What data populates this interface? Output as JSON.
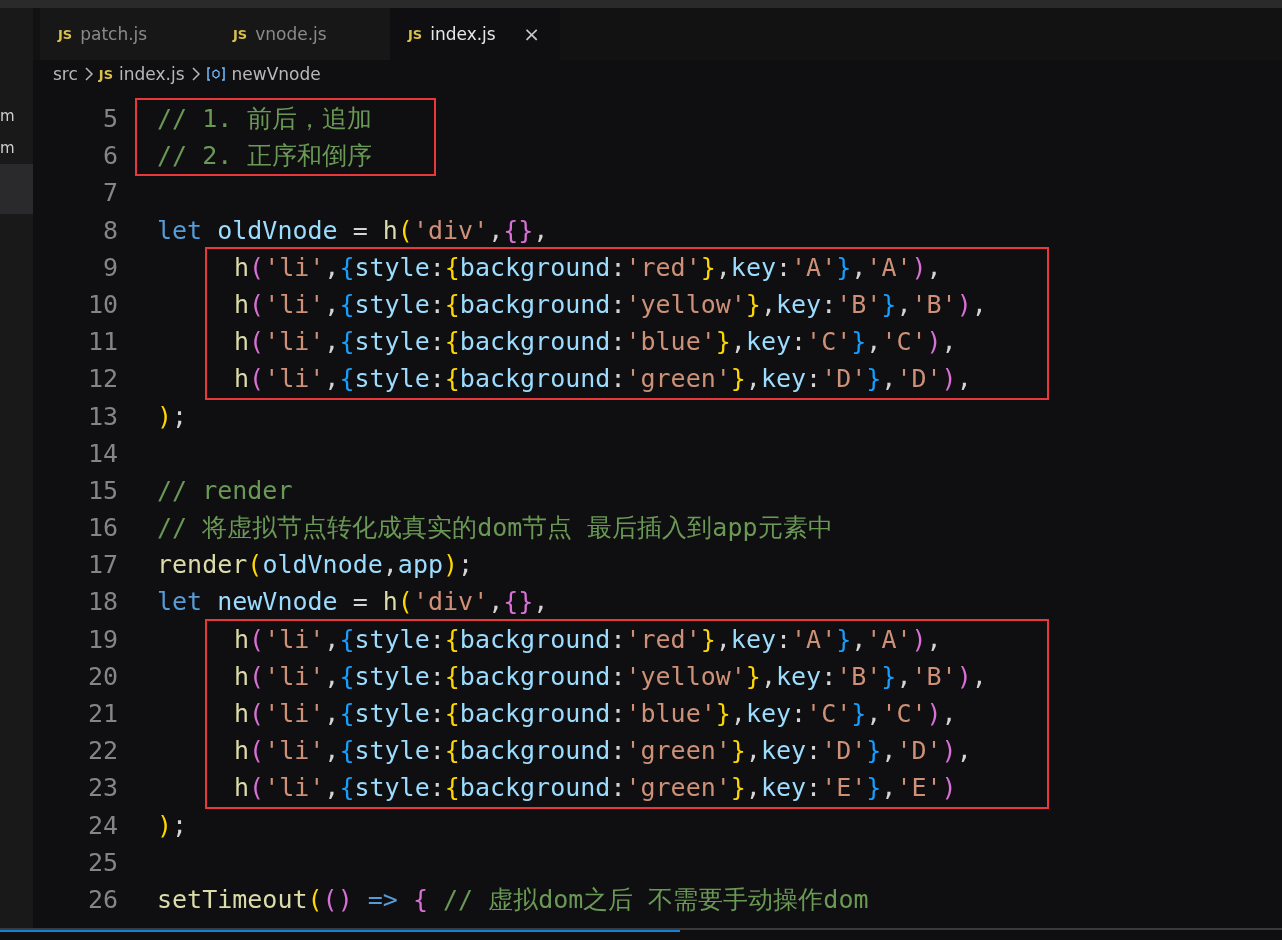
{
  "sidebar": {
    "items": [
      {
        "label": "m",
        "selected": false
      },
      {
        "label": "m",
        "selected": false
      }
    ]
  },
  "tabs": [
    {
      "label": "patch.js",
      "badge": "JS",
      "selected": false
    },
    {
      "label": "vnode.js",
      "badge": "JS",
      "selected": false
    },
    {
      "label": "index.js",
      "badge": "JS",
      "selected": true,
      "close": "×"
    }
  ],
  "breadcrumb": [
    {
      "kind": "folder",
      "label": "src"
    },
    {
      "kind": "file",
      "badge": "JS",
      "label": "index.js"
    },
    {
      "kind": "symbol",
      "label": "newVnode"
    }
  ],
  "editor": {
    "segments": [
      {
        "kind": "box",
        "indented": false,
        "lines": [
          {
            "number": "5",
            "tokens": [
              {
                "kind": "cm",
                "text": "// 1. 前后，追加"
              }
            ]
          },
          {
            "number": "6",
            "tokens": [
              {
                "kind": "cm",
                "text": "// 2. 正序和倒序"
              }
            ]
          }
        ]
      },
      {
        "kind": "line",
        "number": "7"
      },
      {
        "kind": "line",
        "number": "8",
        "tokens": [
          {
            "kind": "kw",
            "text": "let "
          },
          {
            "kind": "var",
            "text": "oldVnode"
          },
          {
            "kind": "p",
            "text": " = "
          },
          {
            "kind": "fn",
            "text": "h"
          },
          {
            "kind": "b1",
            "text": "("
          },
          {
            "kind": "str",
            "text": "'div'"
          },
          {
            "kind": "p",
            "text": ","
          },
          {
            "kind": "b2",
            "text": "{}"
          },
          {
            "kind": "p",
            "text": ","
          }
        ]
      },
      {
        "kind": "box",
        "indented": true,
        "lines": [
          {
            "number": "9",
            "tokens": [
              {
                "kind": "fn",
                "text": "h"
              },
              {
                "kind": "b2",
                "text": "("
              },
              {
                "kind": "str",
                "text": "'li'"
              },
              {
                "kind": "p",
                "text": ","
              },
              {
                "kind": "b3",
                "text": "{"
              },
              {
                "kind": "var",
                "text": "style"
              },
              {
                "kind": "p",
                "text": ":"
              },
              {
                "kind": "b1",
                "text": "{"
              },
              {
                "kind": "var",
                "text": "background"
              },
              {
                "kind": "p",
                "text": ":"
              },
              {
                "kind": "str",
                "text": "'red'"
              },
              {
                "kind": "b1",
                "text": "}"
              },
              {
                "kind": "p",
                "text": ","
              },
              {
                "kind": "var",
                "text": "key"
              },
              {
                "kind": "p",
                "text": ":"
              },
              {
                "kind": "str",
                "text": "'A'"
              },
              {
                "kind": "b3",
                "text": "}"
              },
              {
                "kind": "p",
                "text": ","
              },
              {
                "kind": "str",
                "text": "'A'"
              },
              {
                "kind": "b2",
                "text": ")"
              },
              {
                "kind": "p",
                "text": ","
              }
            ]
          },
          {
            "number": "10",
            "tokens": [
              {
                "kind": "fn",
                "text": "h"
              },
              {
                "kind": "b2",
                "text": "("
              },
              {
                "kind": "str",
                "text": "'li'"
              },
              {
                "kind": "p",
                "text": ","
              },
              {
                "kind": "b3",
                "text": "{"
              },
              {
                "kind": "var",
                "text": "style"
              },
              {
                "kind": "p",
                "text": ":"
              },
              {
                "kind": "b1",
                "text": "{"
              },
              {
                "kind": "var",
                "text": "background"
              },
              {
                "kind": "p",
                "text": ":"
              },
              {
                "kind": "str",
                "text": "'yellow'"
              },
              {
                "kind": "b1",
                "text": "}"
              },
              {
                "kind": "p",
                "text": ","
              },
              {
                "kind": "var",
                "text": "key"
              },
              {
                "kind": "p",
                "text": ":"
              },
              {
                "kind": "str",
                "text": "'B'"
              },
              {
                "kind": "b3",
                "text": "}"
              },
              {
                "kind": "p",
                "text": ","
              },
              {
                "kind": "str",
                "text": "'B'"
              },
              {
                "kind": "b2",
                "text": ")"
              },
              {
                "kind": "p",
                "text": ","
              }
            ]
          },
          {
            "number": "11",
            "tokens": [
              {
                "kind": "fn",
                "text": "h"
              },
              {
                "kind": "b2",
                "text": "("
              },
              {
                "kind": "str",
                "text": "'li'"
              },
              {
                "kind": "p",
                "text": ","
              },
              {
                "kind": "b3",
                "text": "{"
              },
              {
                "kind": "var",
                "text": "style"
              },
              {
                "kind": "p",
                "text": ":"
              },
              {
                "kind": "b1",
                "text": "{"
              },
              {
                "kind": "var",
                "text": "background"
              },
              {
                "kind": "p",
                "text": ":"
              },
              {
                "kind": "str",
                "text": "'blue'"
              },
              {
                "kind": "b1",
                "text": "}"
              },
              {
                "kind": "p",
                "text": ","
              },
              {
                "kind": "var",
                "text": "key"
              },
              {
                "kind": "p",
                "text": ":"
              },
              {
                "kind": "str",
                "text": "'C'"
              },
              {
                "kind": "b3",
                "text": "}"
              },
              {
                "kind": "p",
                "text": ","
              },
              {
                "kind": "str",
                "text": "'C'"
              },
              {
                "kind": "b2",
                "text": ")"
              },
              {
                "kind": "p",
                "text": ","
              }
            ]
          },
          {
            "number": "12",
            "tokens": [
              {
                "kind": "fn",
                "text": "h"
              },
              {
                "kind": "b2",
                "text": "("
              },
              {
                "kind": "str",
                "text": "'li'"
              },
              {
                "kind": "p",
                "text": ","
              },
              {
                "kind": "b3",
                "text": "{"
              },
              {
                "kind": "var",
                "text": "style"
              },
              {
                "kind": "p",
                "text": ":"
              },
              {
                "kind": "b1",
                "text": "{"
              },
              {
                "kind": "var",
                "text": "background"
              },
              {
                "kind": "p",
                "text": ":"
              },
              {
                "kind": "str",
                "text": "'green'"
              },
              {
                "kind": "b1",
                "text": "}"
              },
              {
                "kind": "p",
                "text": ","
              },
              {
                "kind": "var",
                "text": "key"
              },
              {
                "kind": "p",
                "text": ":"
              },
              {
                "kind": "str",
                "text": "'D'"
              },
              {
                "kind": "b3",
                "text": "}"
              },
              {
                "kind": "p",
                "text": ","
              },
              {
                "kind": "str",
                "text": "'D'"
              },
              {
                "kind": "b2",
                "text": ")"
              },
              {
                "kind": "p",
                "text": ","
              }
            ]
          }
        ]
      },
      {
        "kind": "line",
        "number": "13",
        "tokens": [
          {
            "kind": "b1",
            "text": ")"
          },
          {
            "kind": "p",
            "text": ";"
          }
        ]
      },
      {
        "kind": "line",
        "number": "14"
      },
      {
        "kind": "line",
        "number": "15",
        "tokens": [
          {
            "kind": "cm",
            "text": "// render"
          }
        ]
      },
      {
        "kind": "line",
        "number": "16",
        "tokens": [
          {
            "kind": "cm",
            "text": "// 将虚拟节点转化成真实的dom节点 最后插入到app元素中"
          }
        ]
      },
      {
        "kind": "line",
        "number": "17",
        "tokens": [
          {
            "kind": "fn",
            "text": "render"
          },
          {
            "kind": "b1",
            "text": "("
          },
          {
            "kind": "var",
            "text": "oldVnode"
          },
          {
            "kind": "p",
            "text": ","
          },
          {
            "kind": "var",
            "text": "app"
          },
          {
            "kind": "b1",
            "text": ")"
          },
          {
            "kind": "p",
            "text": ";"
          }
        ]
      },
      {
        "kind": "line",
        "number": "18",
        "tokens": [
          {
            "kind": "kw",
            "text": "let "
          },
          {
            "kind": "var",
            "text": "newVnode"
          },
          {
            "kind": "p",
            "text": " = "
          },
          {
            "kind": "fn",
            "text": "h"
          },
          {
            "kind": "b1",
            "text": "("
          },
          {
            "kind": "str",
            "text": "'div'"
          },
          {
            "kind": "p",
            "text": ","
          },
          {
            "kind": "b2",
            "text": "{}"
          },
          {
            "kind": "p",
            "text": ","
          }
        ]
      },
      {
        "kind": "box",
        "indented": true,
        "lines": [
          {
            "number": "19",
            "tokens": [
              {
                "kind": "fn",
                "text": "h"
              },
              {
                "kind": "b2",
                "text": "("
              },
              {
                "kind": "str",
                "text": "'li'"
              },
              {
                "kind": "p",
                "text": ","
              },
              {
                "kind": "b3",
                "text": "{"
              },
              {
                "kind": "var",
                "text": "style"
              },
              {
                "kind": "p",
                "text": ":"
              },
              {
                "kind": "b1",
                "text": "{"
              },
              {
                "kind": "var",
                "text": "background"
              },
              {
                "kind": "p",
                "text": ":"
              },
              {
                "kind": "str",
                "text": "'red'"
              },
              {
                "kind": "b1",
                "text": "}"
              },
              {
                "kind": "p",
                "text": ","
              },
              {
                "kind": "var",
                "text": "key"
              },
              {
                "kind": "p",
                "text": ":"
              },
              {
                "kind": "str",
                "text": "'A'"
              },
              {
                "kind": "b3",
                "text": "}"
              },
              {
                "kind": "p",
                "text": ","
              },
              {
                "kind": "str",
                "text": "'A'"
              },
              {
                "kind": "b2",
                "text": ")"
              },
              {
                "kind": "p",
                "text": ","
              }
            ]
          },
          {
            "number": "20",
            "tokens": [
              {
                "kind": "fn",
                "text": "h"
              },
              {
                "kind": "b2",
                "text": "("
              },
              {
                "kind": "str",
                "text": "'li'"
              },
              {
                "kind": "p",
                "text": ","
              },
              {
                "kind": "b3",
                "text": "{"
              },
              {
                "kind": "var",
                "text": "style"
              },
              {
                "kind": "p",
                "text": ":"
              },
              {
                "kind": "b1",
                "text": "{"
              },
              {
                "kind": "var",
                "text": "background"
              },
              {
                "kind": "p",
                "text": ":"
              },
              {
                "kind": "str",
                "text": "'yellow'"
              },
              {
                "kind": "b1",
                "text": "}"
              },
              {
                "kind": "p",
                "text": ","
              },
              {
                "kind": "var",
                "text": "key"
              },
              {
                "kind": "p",
                "text": ":"
              },
              {
                "kind": "str",
                "text": "'B'"
              },
              {
                "kind": "b3",
                "text": "}"
              },
              {
                "kind": "p",
                "text": ","
              },
              {
                "kind": "str",
                "text": "'B'"
              },
              {
                "kind": "b2",
                "text": ")"
              },
              {
                "kind": "p",
                "text": ","
              }
            ]
          },
          {
            "number": "21",
            "tokens": [
              {
                "kind": "fn",
                "text": "h"
              },
              {
                "kind": "b2",
                "text": "("
              },
              {
                "kind": "str",
                "text": "'li'"
              },
              {
                "kind": "p",
                "text": ","
              },
              {
                "kind": "b3",
                "text": "{"
              },
              {
                "kind": "var",
                "text": "style"
              },
              {
                "kind": "p",
                "text": ":"
              },
              {
                "kind": "b1",
                "text": "{"
              },
              {
                "kind": "var",
                "text": "background"
              },
              {
                "kind": "p",
                "text": ":"
              },
              {
                "kind": "str",
                "text": "'blue'"
              },
              {
                "kind": "b1",
                "text": "}"
              },
              {
                "kind": "p",
                "text": ","
              },
              {
                "kind": "var",
                "text": "key"
              },
              {
                "kind": "p",
                "text": ":"
              },
              {
                "kind": "str",
                "text": "'C'"
              },
              {
                "kind": "b3",
                "text": "}"
              },
              {
                "kind": "p",
                "text": ","
              },
              {
                "kind": "str",
                "text": "'C'"
              },
              {
                "kind": "b2",
                "text": ")"
              },
              {
                "kind": "p",
                "text": ","
              }
            ]
          },
          {
            "number": "22",
            "tokens": [
              {
                "kind": "fn",
                "text": "h"
              },
              {
                "kind": "b2",
                "text": "("
              },
              {
                "kind": "str",
                "text": "'li'"
              },
              {
                "kind": "p",
                "text": ","
              },
              {
                "kind": "b3",
                "text": "{"
              },
              {
                "kind": "var",
                "text": "style"
              },
              {
                "kind": "p",
                "text": ":"
              },
              {
                "kind": "b1",
                "text": "{"
              },
              {
                "kind": "var",
                "text": "background"
              },
              {
                "kind": "p",
                "text": ":"
              },
              {
                "kind": "str",
                "text": "'green'"
              },
              {
                "kind": "b1",
                "text": "}"
              },
              {
                "kind": "p",
                "text": ","
              },
              {
                "kind": "var",
                "text": "key"
              },
              {
                "kind": "p",
                "text": ":"
              },
              {
                "kind": "str",
                "text": "'D'"
              },
              {
                "kind": "b3",
                "text": "}"
              },
              {
                "kind": "p",
                "text": ","
              },
              {
                "kind": "str",
                "text": "'D'"
              },
              {
                "kind": "b2",
                "text": ")"
              },
              {
                "kind": "p",
                "text": ","
              }
            ]
          },
          {
            "number": "23",
            "tokens": [
              {
                "kind": "fn",
                "text": "h"
              },
              {
                "kind": "b2",
                "text": "("
              },
              {
                "kind": "str",
                "text": "'li'"
              },
              {
                "kind": "p",
                "text": ","
              },
              {
                "kind": "b3",
                "text": "{"
              },
              {
                "kind": "var",
                "text": "style"
              },
              {
                "kind": "p",
                "text": ":"
              },
              {
                "kind": "b1",
                "text": "{"
              },
              {
                "kind": "var",
                "text": "background"
              },
              {
                "kind": "p",
                "text": ":"
              },
              {
                "kind": "str",
                "text": "'green'"
              },
              {
                "kind": "b1",
                "text": "}"
              },
              {
                "kind": "p",
                "text": ","
              },
              {
                "kind": "var",
                "text": "key"
              },
              {
                "kind": "p",
                "text": ":"
              },
              {
                "kind": "str",
                "text": "'E'"
              },
              {
                "kind": "b3",
                "text": "}"
              },
              {
                "kind": "p",
                "text": ","
              },
              {
                "kind": "str",
                "text": "'E'"
              },
              {
                "kind": "b2",
                "text": ")"
              }
            ]
          }
        ]
      },
      {
        "kind": "line",
        "number": "24",
        "tokens": [
          {
            "kind": "b1",
            "text": ")"
          },
          {
            "kind": "p",
            "text": ";"
          }
        ]
      },
      {
        "kind": "line",
        "number": "25"
      },
      {
        "kind": "line",
        "number": "26",
        "tokens": [
          {
            "kind": "fn",
            "text": "setTimeout"
          },
          {
            "kind": "b1",
            "text": "("
          },
          {
            "kind": "b2",
            "text": "() "
          },
          {
            "kind": "kw",
            "text": "=> "
          },
          {
            "kind": "b2",
            "text": "{ "
          },
          {
            "kind": "cm",
            "text": "// 虚拟dom之后 不需要手动操作dom"
          }
        ]
      }
    ]
  }
}
